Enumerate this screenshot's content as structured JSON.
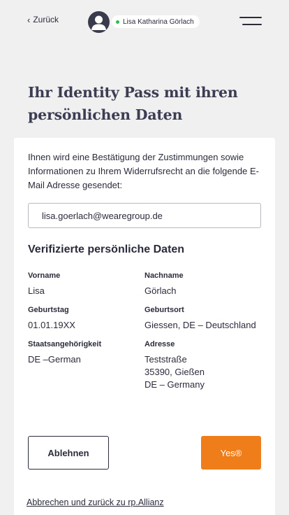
{
  "header": {
    "back_label": "Zurück",
    "user_name": "Lisa Katharina Görlach",
    "status_color": "#2ebc4f"
  },
  "page": {
    "title": "Ihr Identity Pass mit ihren persönlichen Daten"
  },
  "consent": {
    "intro_text": "Ihnen wird eine Bestätigung der Zustimmungen sowie Informationen zu Ihrem Widerrufsrecht an die folgende E-Mail Adresse gesendet:",
    "email_value": "lisa.goerlach@wearegroup.de"
  },
  "personal_data": {
    "section_title": "Verifizierte persönliche Daten",
    "fields": [
      {
        "label": "Vorname",
        "value": "Lisa"
      },
      {
        "label": "Nachname",
        "value": "Görlach"
      },
      {
        "label": "Geburtstag",
        "value": "01.01.19XX"
      },
      {
        "label": "Geburtsort",
        "value": "Giessen, DE – Deutschland"
      },
      {
        "label": "Staatsangehörigkeit",
        "value": "DE –German"
      },
      {
        "label": "Adresse",
        "value_lines": [
          "Teststraße",
          "35390, Gießen",
          "DE – Germany"
        ]
      }
    ]
  },
  "actions": {
    "decline_label": "Ablehnen",
    "accept_label": "Yes®",
    "accept_color": "#ee7d1a",
    "cancel_link": "Abbrechen und zurück zu rp.Allianz"
  }
}
